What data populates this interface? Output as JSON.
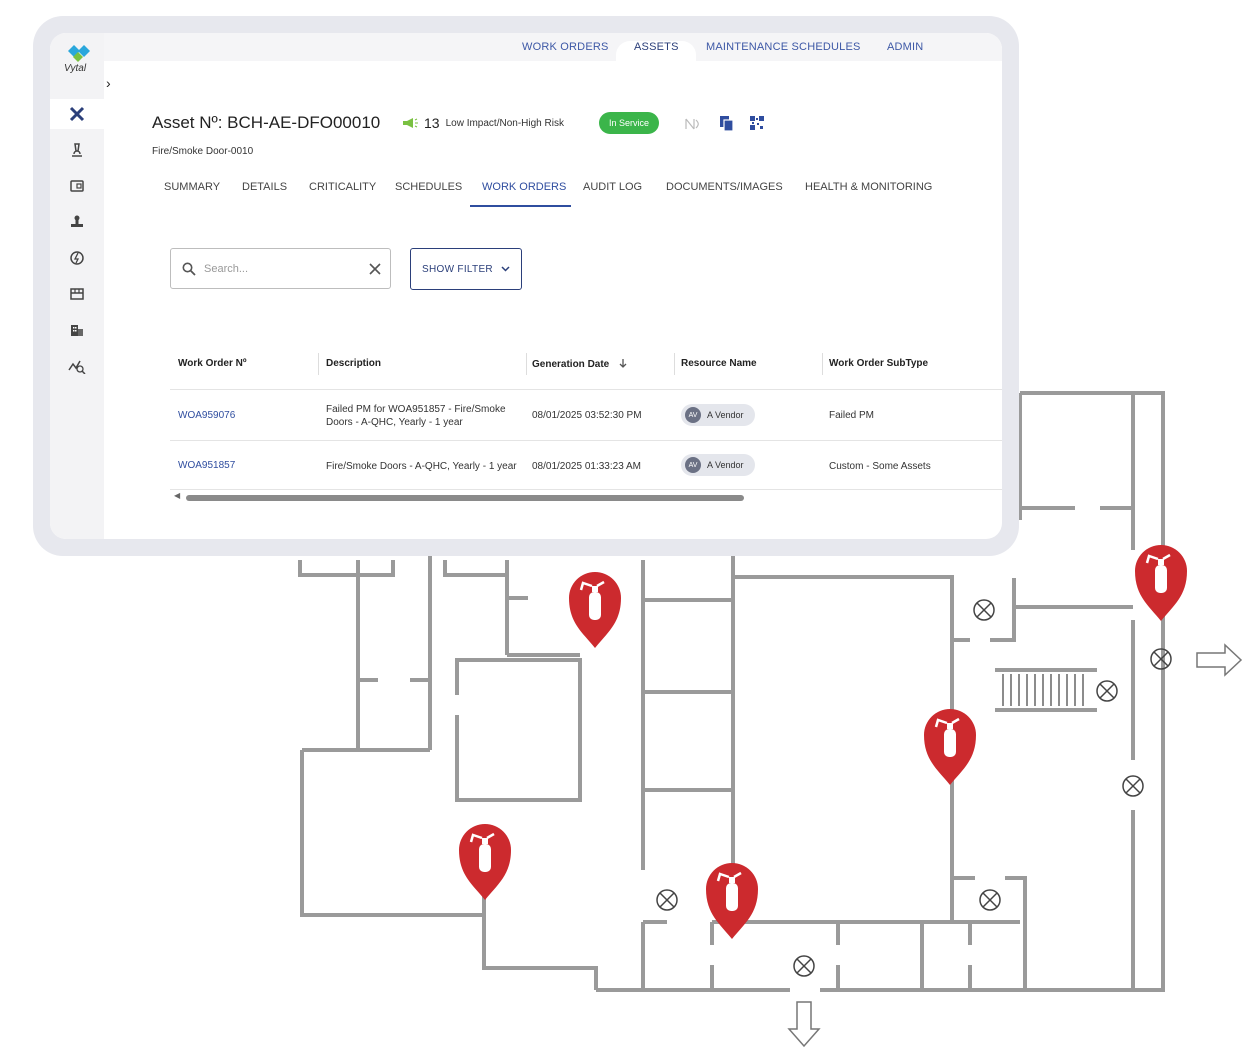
{
  "top_nav": {
    "items": [
      "WORK ORDERS",
      "ASSETS",
      "MAINTENANCE SCHEDULES",
      "ADMIN"
    ],
    "active_index": 1
  },
  "brand": {
    "name": "Vytal"
  },
  "sidebar": {
    "icons": [
      "tools-icon",
      "microscope-icon",
      "wallet-icon",
      "stamp-icon",
      "energy-icon",
      "storefront-icon",
      "buildings-icon",
      "analytics-icon"
    ],
    "active_index": 0
  },
  "asset": {
    "title": "Asset Nº: BCH-AE-DFO00010",
    "risk_number": "13",
    "risk_label": "Low Impact/Non-High Risk",
    "status": "In Service",
    "subtitle": "Fire/Smoke Door-0010"
  },
  "tabs": [
    "SUMMARY",
    "DETAILS",
    "CRITICALITY",
    "SCHEDULES",
    "WORK ORDERS",
    "AUDIT LOG",
    "DOCUMENTS/IMAGES",
    "HEALTH & MONITORING"
  ],
  "active_tab_index": 4,
  "search": {
    "placeholder": "Search..."
  },
  "filter": {
    "label": "SHOW FILTER"
  },
  "table": {
    "columns": [
      "Work Order Nº",
      "Description",
      "Generation Date",
      "Resource Name",
      "Work Order SubType"
    ],
    "rows": [
      {
        "id": "WOA959076",
        "description_line1": "Failed PM for WOA951857 - Fire/Smoke",
        "description_line2": "Doors - A-QHC, Yearly - 1 year",
        "date": "08/01/2025 03:52:30 PM",
        "resource_initials": "AV",
        "resource_name": "A Vendor",
        "subtype": "Failed PM"
      },
      {
        "id": "WOA951857",
        "description_line1": "Fire/Smoke Doors - A-QHC, Yearly - 1 year",
        "description_line2": "",
        "date": "08/01/2025 01:33:23 AM",
        "resource_initials": "AV",
        "resource_name": "A Vendor",
        "subtype": "Custom - Some Assets"
      }
    ]
  },
  "colors": {
    "accent": "#2f4d9f",
    "status_green": "#3bb54a",
    "marker_red": "#cc2a2e",
    "wall_gray": "#9a9a9a"
  }
}
